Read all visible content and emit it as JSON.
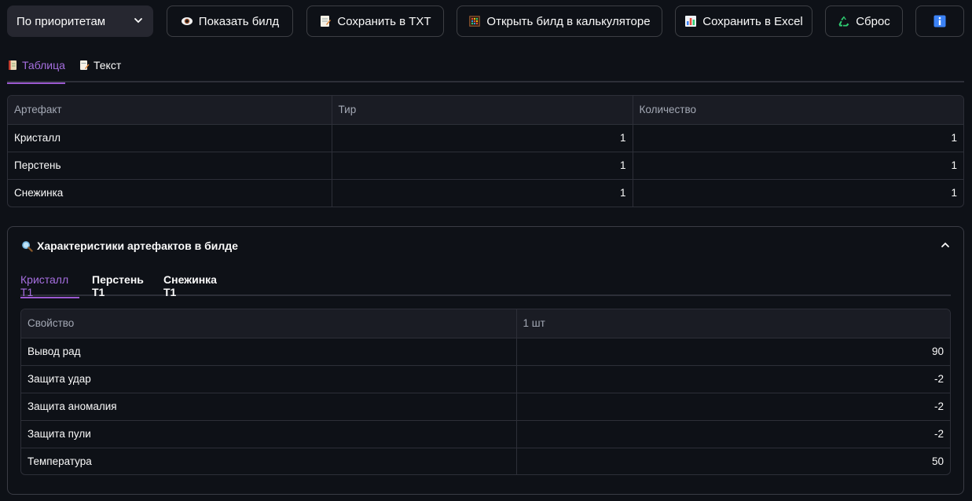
{
  "toolbar": {
    "select_value": "По приоритетам",
    "buttons": [
      {
        "label": "Показать билд",
        "icon": "eye-icon"
      },
      {
        "label": "Сохранить в TXT",
        "icon": "memo-icon"
      },
      {
        "label": "Открыть билд в калькуляторе",
        "icon": "abacus-icon"
      },
      {
        "label": "Сохранить в Excel",
        "icon": "bar-chart-icon"
      },
      {
        "label": "Сброс",
        "icon": "recycle-icon"
      },
      {
        "label": "",
        "icon": "info-icon"
      }
    ]
  },
  "main_tabs": [
    {
      "label": "Таблица",
      "icon": "ledger-icon",
      "active": true
    },
    {
      "label": "Текст",
      "icon": "memo-icon",
      "active": false
    }
  ],
  "artifacts_table": {
    "headers": [
      "Артефакт",
      "Тир",
      "Количество"
    ],
    "rows": [
      [
        "Кристалл",
        "1",
        "1"
      ],
      [
        "Перстень",
        "1",
        "1"
      ],
      [
        "Снежинка",
        "1",
        "1"
      ]
    ]
  },
  "expander": {
    "title": "Характеристики артефактов в билде",
    "icon": "magnifier-icon",
    "tabs": [
      {
        "label": "Кристалл Т1",
        "active": true
      },
      {
        "label": "Перстень Т1",
        "active": false
      },
      {
        "label": "Снежинка Т1",
        "active": false
      }
    ],
    "props_table": {
      "headers": [
        "Свойство",
        "1 шт"
      ],
      "rows": [
        [
          "Вывод рад",
          "90"
        ],
        [
          "Защита удар",
          "-2"
        ],
        [
          "Защита аномалия",
          "-2"
        ],
        [
          "Защита пули",
          "-2"
        ],
        [
          "Температура",
          "50"
        ]
      ]
    }
  },
  "colors": {
    "background": "#0e1117",
    "accent": "#a66fe0",
    "info_blue": "#3b82f6"
  }
}
